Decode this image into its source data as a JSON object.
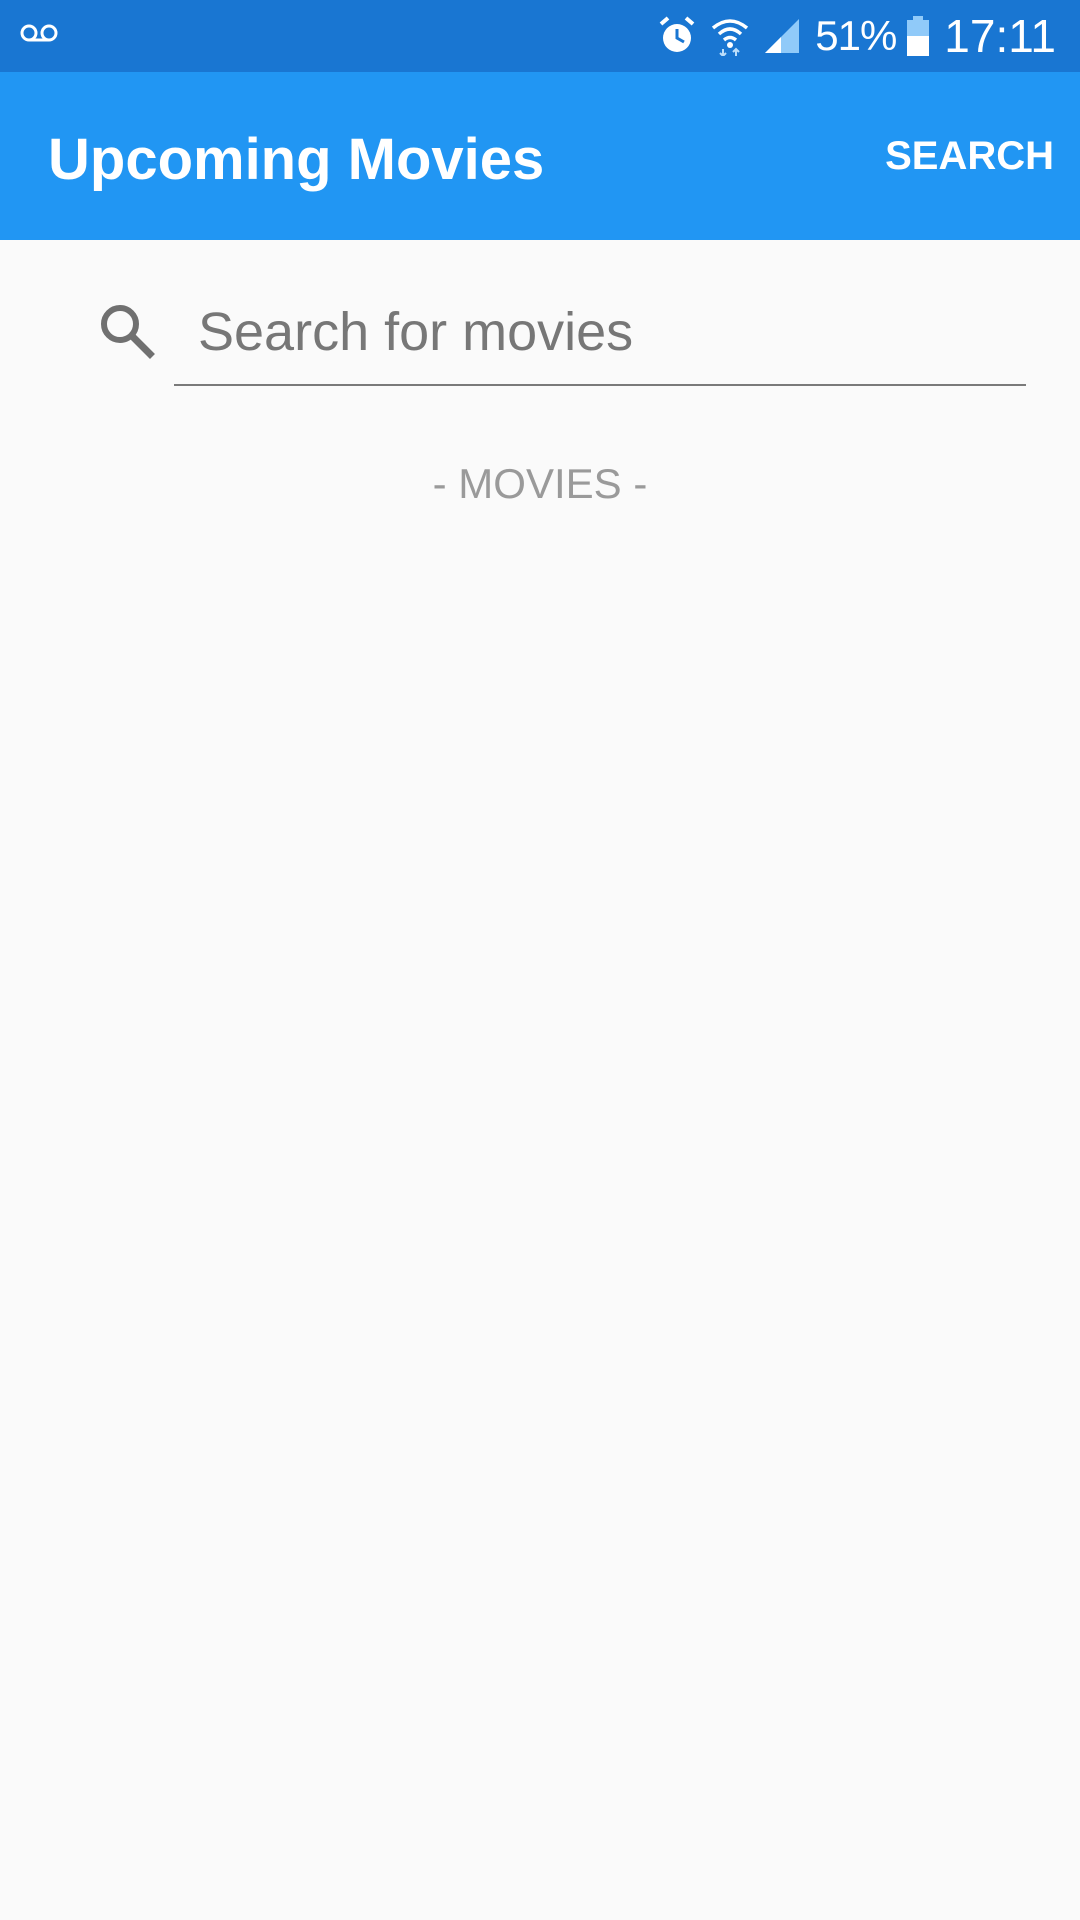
{
  "status_bar": {
    "left_icon": "voicemail-icon",
    "icons": [
      "alarm-icon",
      "wifi-icon",
      "cell-signal-icon",
      "battery-icon"
    ],
    "battery_percent": "51%",
    "time": "17:11"
  },
  "app_bar": {
    "title": "Upcoming Movies",
    "action_label": "SEARCH",
    "color": "#2196f3"
  },
  "search": {
    "icon": "search-icon",
    "placeholder": "Search for movies",
    "value": ""
  },
  "content": {
    "section_label": "- MOVIES -"
  },
  "colors": {
    "status_bar": "#1976d2",
    "background": "#fafafa"
  }
}
